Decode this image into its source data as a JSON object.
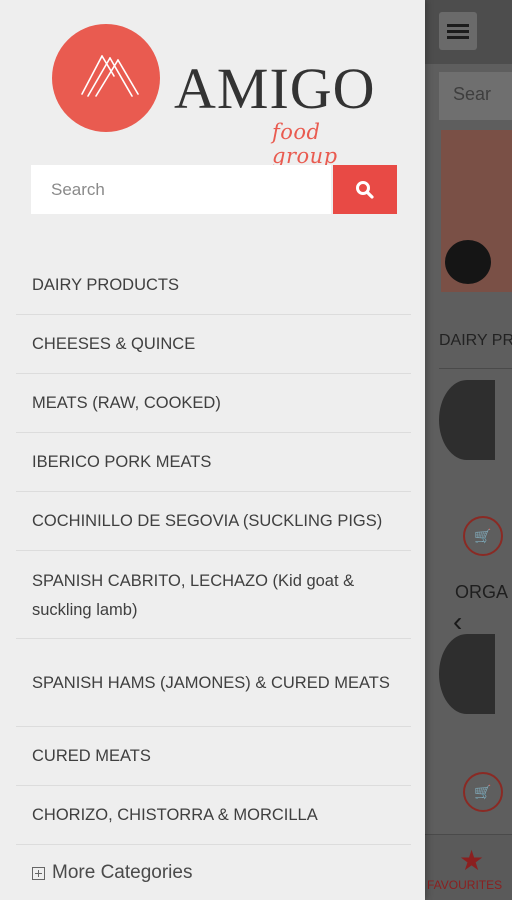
{
  "brand": {
    "name": "AMIGO",
    "tagline": "food group"
  },
  "search": {
    "placeholder": "Search"
  },
  "categories": [
    "DAIRY PRODUCTS",
    "CHEESES & QUINCE",
    "MEATS (RAW, COOKED)",
    "IBERICO PORK MEATS",
    "COCHINILLO DE SEGOVIA (SUCKLING PIGS)",
    "SPANISH CABRITO, LECHAZO (Kid goat & suckling lamb)",
    "SPANISH HAMS (JAMONES) & CURED MEATS",
    "CURED MEATS",
    "CHORIZO, CHISTORRA & MORCILLA"
  ],
  "more_categories": "More Categories",
  "background": {
    "search_text": "Sear",
    "section_1": "DAIRY PR",
    "section_2": "ORGA",
    "favourites_label": "FAVOURITES"
  },
  "colors": {
    "accent": "#e84a45",
    "drawer_bg": "#eeeeee",
    "text": "#3f3f3f"
  }
}
